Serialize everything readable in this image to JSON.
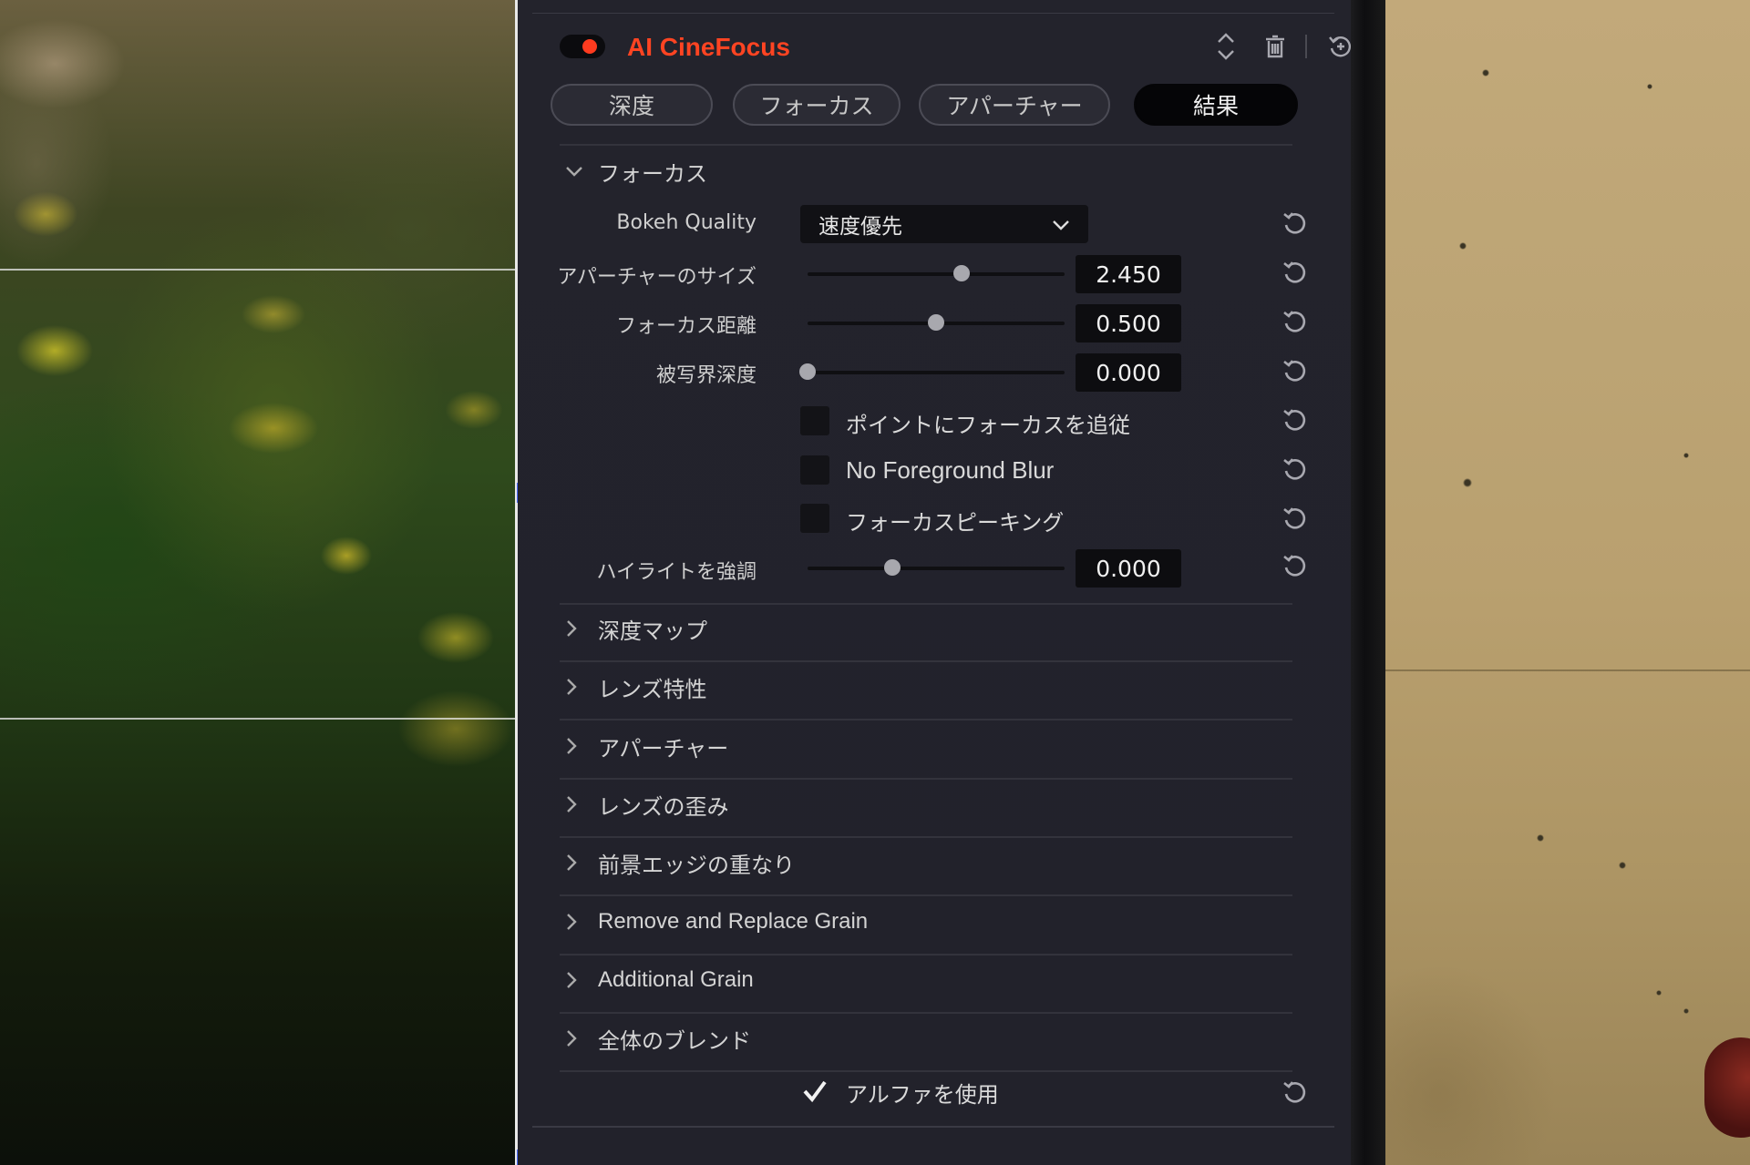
{
  "effect": {
    "title": "AI CineFocus",
    "enabled": true,
    "accent_color": "#ff4422",
    "header_icons": [
      "up-down-arrows-icon",
      "trash-icon",
      "reset-icon"
    ]
  },
  "tabs": [
    {
      "label": "深度",
      "active": false
    },
    {
      "label": "フォーカス",
      "active": false
    },
    {
      "label": "アパーチャー",
      "active": false
    },
    {
      "label": "結果",
      "active": true
    }
  ],
  "focus_section": {
    "title": "フォーカス",
    "expanded": true,
    "bokeh_quality": {
      "label": "Bokeh Quality",
      "value": "速度優先"
    },
    "aperture_size": {
      "label": "アパーチャーのサイズ",
      "value": "2.450",
      "slider_fraction": 0.6
    },
    "focus_distance": {
      "label": "フォーカス距離",
      "value": "0.500",
      "slider_fraction": 0.5
    },
    "depth_of_field": {
      "label": "被写界深度",
      "value": "0.000",
      "slider_fraction": 0.0
    },
    "track_focus": {
      "label": "ポイントにフォーカスを追従",
      "checked": false
    },
    "no_foreground_blur": {
      "label": "No Foreground Blur",
      "checked": false
    },
    "focus_peaking": {
      "label": "フォーカスピーキング",
      "checked": false
    },
    "highlight_boost": {
      "label": "ハイライトを強調",
      "value": "0.000",
      "slider_fraction": 0.33
    }
  },
  "collapsed_sections": [
    "深度マップ",
    "レンズ特性",
    "アパーチャー",
    "レンズの歪み",
    "前景エッジの重なり",
    "Remove and Replace Grain",
    "Additional Grain",
    "全体のブレンド"
  ],
  "use_alpha": {
    "label": "アルファを使用",
    "checked": true
  }
}
